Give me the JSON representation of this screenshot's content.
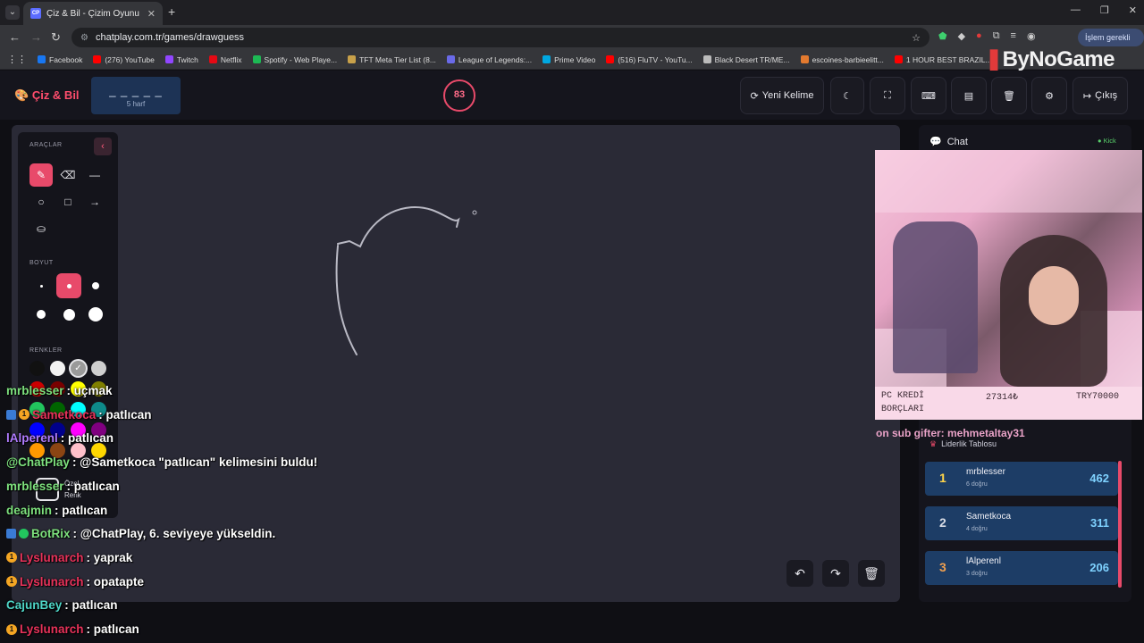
{
  "browser": {
    "tab_title": "Çiz & Bil - Çizim Oyunu",
    "tab_favicon": "CP",
    "url": "chatplay.com.tr/games/drawguess",
    "profile_label": "İşlem gerekli",
    "bookmarks": [
      {
        "label": "Facebook",
        "color": "#1877f2"
      },
      {
        "label": "(276) YouTube",
        "color": "#ff0000"
      },
      {
        "label": "Twitch",
        "color": "#9146ff"
      },
      {
        "label": "Netflix",
        "color": "#e50914"
      },
      {
        "label": "Spotify - Web Playe...",
        "color": "#1db954"
      },
      {
        "label": "TFT Meta Tier List (8...",
        "color": "#c8a14a"
      },
      {
        "label": "League of Legends:...",
        "color": "#6a6ae8"
      },
      {
        "label": "Prime Video",
        "color": "#00a8e1"
      },
      {
        "label": "(516) FluTV - YouTu...",
        "color": "#ff0000"
      },
      {
        "label": "Black Desert TR/ME...",
        "color": "#bbbbbb"
      },
      {
        "label": "escoines-barbieelitt...",
        "color": "#e37a2f"
      },
      {
        "label": "1 HOUR BEST BRAZIL...",
        "color": "#ff0000"
      }
    ],
    "watermark": "ByNoGame"
  },
  "header": {
    "logo": "Çiz & Bil",
    "word_blanks": "_ _ _ _ _",
    "word_hint": "5 harf",
    "timer": "83",
    "new_word_label": "Yeni Kelime",
    "exit_label": "Çıkış"
  },
  "tools": {
    "section_tools": "ARAÇLAR",
    "section_size": "BOYUT",
    "section_colors": "RENKLER",
    "custom_color_label": "Özel Renk",
    "swatches": [
      "#111111",
      "#f2f2f2",
      "#9a9a9a",
      "#cfcfcf",
      "#cc0000",
      "#7a0000",
      "#ffff00",
      "#808000",
      "#22c55e",
      "#006400",
      "#00ffff",
      "#0e8a8a",
      "#0000ff",
      "#00008b",
      "#ff00ff",
      "#800080",
      "#ff9900",
      "#8b4513",
      "#ffc0cb",
      "#ffd700"
    ]
  },
  "chat_panel": {
    "title": "Chat",
    "platform": "Kick",
    "cam_info": {
      "left": "PC KREDİ BORÇLARI",
      "amount": "27314₺",
      "goal": "TRY70000"
    },
    "sub_gifter": "on sub gifter: mehmetaltay31"
  },
  "leaderboard": {
    "title": "Liderlik Tablosu",
    "rows": [
      {
        "rank": "1",
        "name": "mrblesser",
        "sub": "6 doğru",
        "score": "462",
        "rank_color": "#ffd54a"
      },
      {
        "rank": "2",
        "name": "Sametkoca",
        "sub": "4 doğru",
        "score": "311",
        "rank_color": "#d9dde6"
      },
      {
        "rank": "3",
        "name": "lAlperenl",
        "sub": "3 doğru",
        "score": "206",
        "rank_color": "#f0a050"
      }
    ]
  },
  "overlay_chat": [
    {
      "user": "mrblesser",
      "user_color": "#7de07d",
      "text": ": uçmak",
      "badges": ""
    },
    {
      "user": "Sametkoca",
      "user_color": "#e8325a",
      "text": ": patlıcan",
      "badges": "sq,badge"
    },
    {
      "user": "lAlperenl",
      "user_color": "#b07cff",
      "text": ": patlıcan",
      "badges": ""
    },
    {
      "user": "@ChatPlay",
      "user_color": "#7de07d",
      "text": ": @Sametkoca \"patlıcan\" kelimesini buldu!",
      "badges": ""
    },
    {
      "user": "mrblesser",
      "user_color": "#7de07d",
      "text": ": patlıcan",
      "badges": ""
    },
    {
      "user": "deajmin",
      "user_color": "#7de07d",
      "text": ": patlıcan",
      "badges": ""
    },
    {
      "user": "BotRix",
      "user_color": "#7de07d",
      "text": ": @ChatPlay, 6. seviyeye yükseldin.",
      "badges": "sq,gc"
    },
    {
      "user": "Lyslunarch",
      "user_color": "#e8325a",
      "text": ": yaprak",
      "badges": "badge"
    },
    {
      "user": "Lyslunarch",
      "user_color": "#e8325a",
      "text": ": opatapte",
      "badges": "badge"
    },
    {
      "user": "CajunBey",
      "user_color": "#4fd6c8",
      "text": ": patlıcan",
      "badges": ""
    },
    {
      "user": "Lyslunarch",
      "user_color": "#e8325a",
      "text": ": patlıcan",
      "badges": "badge"
    }
  ]
}
